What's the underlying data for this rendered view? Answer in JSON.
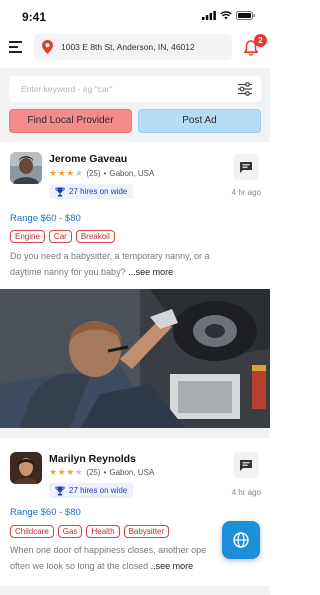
{
  "status_bar": {
    "time": "9:41"
  },
  "header": {
    "location": "1003 E 8th St, Anderson, IN, 46012",
    "notification_count": "2"
  },
  "search": {
    "placeholder": "Enter keyword - eg \"car\"",
    "value": ""
  },
  "actions": {
    "find_provider": "Find Local Provider",
    "post_ad": "Post Ad"
  },
  "listings": [
    {
      "name": "Jerome Gaveau",
      "rating": 3,
      "rating_max": 5,
      "reviews": "(25)",
      "location": "Gabon, USA",
      "hires": "27 hires on wide",
      "time_ago": "4 hr ago",
      "range": "Range $60 - $80",
      "tags": [
        "Engine",
        "Car",
        "Breakoil"
      ],
      "desc_line1": "Do you need a babysitter, a temporary nanny, or a",
      "desc_line2": "daytime nanny for you baby?",
      "see_more": "...see more"
    },
    {
      "name": "Marilyn Reynolds",
      "rating": 3,
      "rating_max": 5,
      "reviews": "(25)",
      "location": "Gabon, USA",
      "hires": "27 hires on wide",
      "time_ago": "4 hr ago",
      "range": "Range $60 - $80",
      "tags": [
        "Childcare",
        "Gas",
        "Health",
        "Babysitter"
      ],
      "desc_line1": "When one door of happiness closes, another ope",
      "desc_line2": "often we look so long at the closed",
      "see_more": "..see more"
    }
  ],
  "colors": {
    "accent_blue": "#1e6fd0",
    "provider_button": "#f48a8a",
    "post_button": "#b5dcf5",
    "tag_red": "#d24545",
    "star": "#f2a72b",
    "fab": "#1d8fd8"
  },
  "icons": [
    "menu-icon",
    "location-pin-icon",
    "bell-icon",
    "filter-icon",
    "chat-icon",
    "trophy-icon",
    "globe-icon",
    "signal-icon",
    "wifi-icon",
    "battery-icon",
    "star-icon"
  ]
}
